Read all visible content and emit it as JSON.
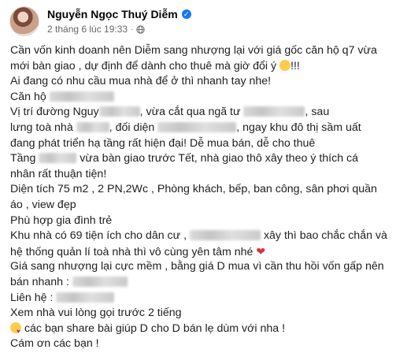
{
  "post": {
    "author": "Nguyễn Ngọc Thuý Diễm",
    "timestamp": "2 tháng 6 lúc 19:33",
    "separator": "·",
    "lines": {
      "l1": "Cần vốn kinh doanh nên Diễm sang nhượng lại với giá gốc căn hộ q7 vừa",
      "l2": "mới bàn giao , dự định để dành cho thuê mà giờ đổi ý",
      "l2b": "!!!",
      "l3": "Ai đang có nhu cầu mua nhà để ở thì nhanh tay nhe!",
      "l4": "Căn hộ",
      "l5a": "Vị trí đường Nguy",
      "l5b": ", vừa cắt qua ngã tư",
      "l5c": ", sau",
      "l6a": "lưng toà nhà",
      "l6b": "đối diện",
      "l6c": ", ngay khu đô thị sầm uất",
      "l7": "đang phát triển hạ tầng rất hiện đại! Dễ mua bán, dễ cho thuê",
      "l8a": "Tầng",
      "l8b": "vừa bàn giao trước Tết, nhà giao thô xây theo ý thích cá",
      "l9": "nhân rất thuận tiện!",
      "l10": "Diện tích 75 m2 , 2 PN,2Wc , Phòng khách, bếp, ban công, sân phơi quần",
      "l11": "áo , view đẹp",
      "l12": "Phù hợp gia đình trẻ",
      "l13a": "Khu nhà có 69 tiện ích cho dân cư ,",
      "l13b": "xây thì bao chắc chắn và",
      "l14": "hệ thống quản lí toà nhà thì vô cùng yên tâm nhé",
      "l15": "Giá sang nhượng lại cực mềm , bằng giá D mua vì cần thu hồi vốn gấp nên",
      "l16": "bán nhanh :",
      "l17": "Liên hệ :",
      "l18": "Xem nhà vui lòng gọi trước 2 tiếng",
      "l19": "các bạn share bài giúp D cho D bán lẹ dùm với nha !",
      "l20": "Cám ơn các bạn !"
    }
  },
  "icons": {
    "verified": "verified-badge-icon",
    "globe": "globe-icon",
    "laugh": "laughing-emoji-icon",
    "heart": "red-heart-emoji-icon",
    "love": "smiling-face-with-hearts-emoji-icon"
  },
  "colors": {
    "verified": "#1877f2",
    "meta": "#65676b",
    "text": "#1c1e21",
    "heart": "#dd2e44"
  }
}
